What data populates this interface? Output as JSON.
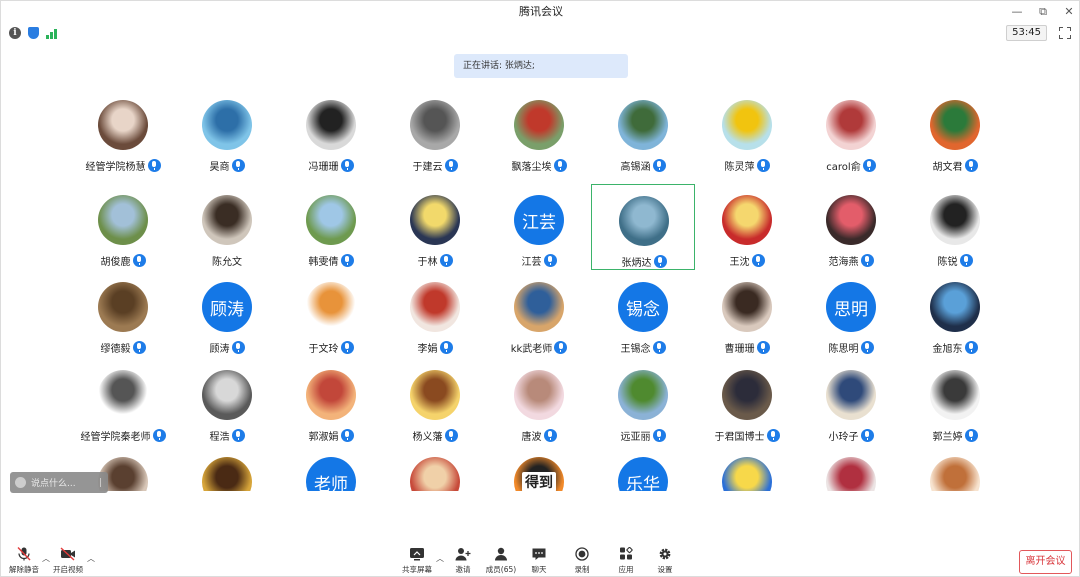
{
  "window": {
    "title": "腾讯会议",
    "controls": [
      "—",
      "⧉",
      "✕"
    ]
  },
  "status": {
    "timer": "53:45"
  },
  "speaking_banner": "正在讲话: 张炳达;",
  "participants": [
    {
      "name": "经管学院杨慧",
      "mic": true,
      "avatar": {
        "type": "photo",
        "bg": "#6b4b3b",
        "fg": "#e8d5c8"
      }
    },
    {
      "name": "昊商",
      "mic": true,
      "avatar": {
        "type": "photo",
        "bg": "#7fc4e8",
        "fg": "#2d6fa8"
      }
    },
    {
      "name": "冯珊珊",
      "mic": true,
      "avatar": {
        "type": "photo",
        "bg": "#d9d9d9",
        "fg": "#222222"
      }
    },
    {
      "name": "于建云",
      "mic": true,
      "avatar": {
        "type": "photo",
        "bg": "#a8a8a8",
        "fg": "#555555"
      }
    },
    {
      "name": "飘落尘埃",
      "mic": true,
      "avatar": {
        "type": "photo",
        "bg": "#7a9f6a",
        "fg": "#c0392b"
      }
    },
    {
      "name": "高锡涵",
      "mic": true,
      "avatar": {
        "type": "photo",
        "bg": "#7fb4d9",
        "fg": "#3f6b3a"
      }
    },
    {
      "name": "陈灵萍",
      "mic": true,
      "avatar": {
        "type": "photo",
        "bg": "#b7e0ea",
        "fg": "#f1c40f"
      }
    },
    {
      "name": "carol俞",
      "mic": true,
      "avatar": {
        "type": "photo",
        "bg": "#f3d3d3",
        "fg": "#b03a3a"
      }
    },
    {
      "name": "胡文君",
      "mic": true,
      "avatar": {
        "type": "photo",
        "bg": "#e1662e",
        "fg": "#2b7a3a"
      }
    },
    {
      "name": "胡俊鹿",
      "mic": true,
      "avatar": {
        "type": "photo",
        "bg": "#6d8f4a",
        "fg": "#a2c0d8"
      }
    },
    {
      "name": "陈允文",
      "mic": false,
      "avatar": {
        "type": "photo",
        "bg": "#cfc6bb",
        "fg": "#3a2d24"
      }
    },
    {
      "name": "韩雯倩",
      "mic": true,
      "avatar": {
        "type": "photo",
        "bg": "#6e9a4f",
        "fg": "#9fc7e6"
      }
    },
    {
      "name": "于林",
      "mic": true,
      "avatar": {
        "type": "photo",
        "bg": "#2a3654",
        "fg": "#f2d96b"
      }
    },
    {
      "name": "江芸",
      "mic": true,
      "avatar": {
        "type": "text",
        "text": "江芸"
      }
    },
    {
      "name": "张炳达",
      "mic": true,
      "selected": true,
      "avatar": {
        "type": "photo",
        "bg": "#3f6f88",
        "fg": "#8fb8d0"
      }
    },
    {
      "name": "王沈",
      "mic": true,
      "avatar": {
        "type": "photo",
        "bg": "#c82b2b",
        "fg": "#f5d76e"
      }
    },
    {
      "name": "范海燕",
      "mic": true,
      "avatar": {
        "type": "photo",
        "bg": "#3a2a2a",
        "fg": "#e35d6a"
      }
    },
    {
      "name": "陈锐",
      "mic": true,
      "avatar": {
        "type": "photo",
        "bg": "#e8e8e8",
        "fg": "#222222"
      }
    },
    {
      "name": "缪德毅",
      "mic": true,
      "avatar": {
        "type": "photo",
        "bg": "#9c7a52",
        "fg": "#5a3f24"
      }
    },
    {
      "name": "顾涛",
      "mic": true,
      "avatar": {
        "type": "text",
        "text": "顾涛"
      }
    },
    {
      "name": "于文玲",
      "mic": true,
      "avatar": {
        "type": "photo",
        "bg": "#ffffff",
        "fg": "#e8933a"
      }
    },
    {
      "name": "李娟",
      "mic": true,
      "avatar": {
        "type": "photo",
        "bg": "#f1e6e0",
        "fg": "#c0392b"
      }
    },
    {
      "name": "kk武老师",
      "mic": true,
      "avatar": {
        "type": "photo",
        "bg": "#d8a56a",
        "fg": "#2f5f9a"
      }
    },
    {
      "name": "王锡念",
      "mic": true,
      "avatar": {
        "type": "text",
        "text": "锡念"
      }
    },
    {
      "name": "曹珊珊",
      "mic": true,
      "avatar": {
        "type": "photo",
        "bg": "#d9c9bd",
        "fg": "#3a2a22"
      }
    },
    {
      "name": "陈思明",
      "mic": true,
      "avatar": {
        "type": "text",
        "text": "思明"
      }
    },
    {
      "name": "金旭东",
      "mic": true,
      "avatar": {
        "type": "photo",
        "bg": "#1f2f4a",
        "fg": "#5aa0d8"
      }
    },
    {
      "name": "经管学院秦老师",
      "mic": true,
      "avatar": {
        "type": "photo",
        "bg": "#ffffff",
        "fg": "#555555"
      }
    },
    {
      "name": "程浩",
      "mic": true,
      "avatar": {
        "type": "photo",
        "bg": "#5a5a5a",
        "fg": "#d8d8d8"
      }
    },
    {
      "name": "郭淑娟",
      "mic": true,
      "avatar": {
        "type": "photo",
        "bg": "#f3b37a",
        "fg": "#c2473a"
      }
    },
    {
      "name": "杨义藩",
      "mic": true,
      "avatar": {
        "type": "photo",
        "bg": "#f5d36b",
        "fg": "#8a4a20"
      }
    },
    {
      "name": "唐波",
      "mic": true,
      "avatar": {
        "type": "photo",
        "bg": "#f2d9e0",
        "fg": "#b88a7a"
      }
    },
    {
      "name": "远亚丽",
      "mic": true,
      "avatar": {
        "type": "photo",
        "bg": "#8bb2d6",
        "fg": "#4f8a2f"
      }
    },
    {
      "name": "于君国博士",
      "mic": true,
      "avatar": {
        "type": "photo",
        "bg": "#6a5a4a",
        "fg": "#2c2c3a"
      }
    },
    {
      "name": "小玲子",
      "mic": true,
      "avatar": {
        "type": "photo",
        "bg": "#e9e0d0",
        "fg": "#2f4a7a"
      }
    },
    {
      "name": "郭兰婷",
      "mic": true,
      "avatar": {
        "type": "photo",
        "bg": "#f2f2f2",
        "fg": "#3a3a3a"
      }
    },
    {
      "name": "",
      "mic": false,
      "avatar": {
        "type": "photo",
        "bg": "#d8c7b8",
        "fg": "#5a4030"
      }
    },
    {
      "name": "",
      "mic": false,
      "avatar": {
        "type": "photo",
        "bg": "#d7a53a",
        "fg": "#4a2a14"
      }
    },
    {
      "name": "",
      "mic": false,
      "avatar": {
        "type": "text",
        "text": "老师"
      }
    },
    {
      "name": "",
      "mic": false,
      "avatar": {
        "type": "photo",
        "bg": "#c74a3a",
        "fg": "#f0d0a8"
      }
    },
    {
      "name": "",
      "mic": false,
      "avatar": {
        "type": "photo",
        "bg": "#f28a2a",
        "fg": "#222222",
        "label": "得到"
      }
    },
    {
      "name": "",
      "mic": false,
      "avatar": {
        "type": "text",
        "text": "乐华"
      }
    },
    {
      "name": "",
      "mic": false,
      "avatar": {
        "type": "photo",
        "bg": "#2a6fd8",
        "fg": "#f7d84a"
      }
    },
    {
      "name": "",
      "mic": false,
      "avatar": {
        "type": "photo",
        "bg": "#ece4e4",
        "fg": "#b03040"
      }
    },
    {
      "name": "",
      "mic": false,
      "avatar": {
        "type": "photo",
        "bg": "#f7e3cf",
        "fg": "#c0703a"
      }
    }
  ],
  "chat": {
    "placeholder": "说点什么...",
    "separator": "|"
  },
  "toolbar": {
    "unmute": "解除静音",
    "start_video": "开启视频",
    "share_screen": "共享屏幕",
    "invite": "邀请",
    "members": "成员(65)",
    "chat": "聊天",
    "record": "录制",
    "apps": "应用",
    "settings": "设置",
    "leave": "离开会议"
  },
  "colors": {
    "accent_blue": "#1e7ce8",
    "selected_border": "#3bb36a",
    "leave_red": "#d8353a",
    "banner_bg": "#dde9fb"
  }
}
